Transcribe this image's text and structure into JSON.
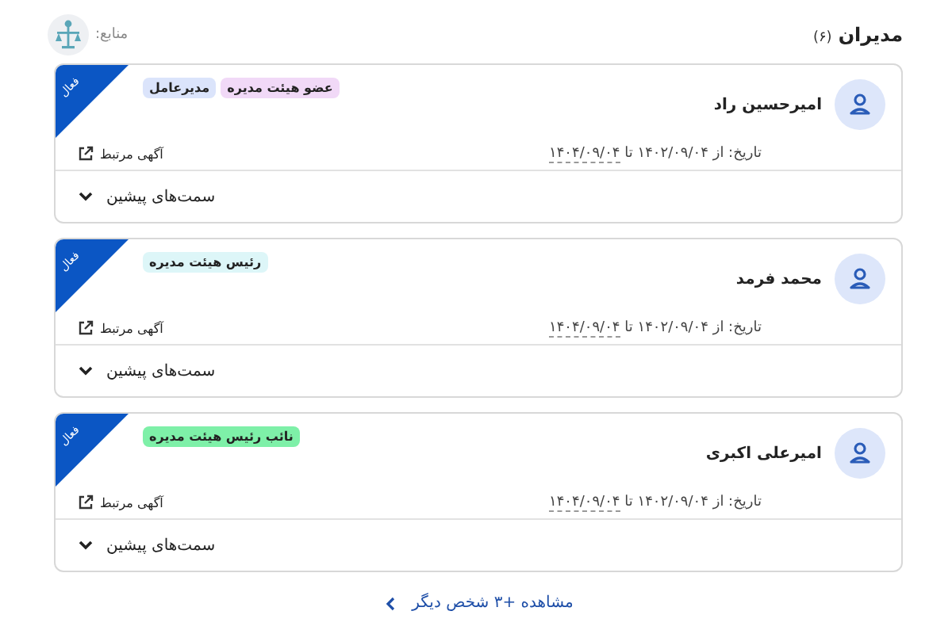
{
  "header": {
    "title": "مدیران",
    "count": "(۶)",
    "sources_label": "منابع:"
  },
  "managers": [
    {
      "name": "امیرحسین راد",
      "status": "فعال",
      "tags": [
        {
          "label": "عضو هیئت مدیره",
          "color": "#f1d9f7"
        },
        {
          "label": "مدیرعامل",
          "color": "#dbe4fb"
        }
      ],
      "date_text": "تاریخ: از ۱۴۰۲/۰۹/۰۴ تا",
      "end_date": "۱۴۰۴/۰۹/۰۴",
      "link": "آگهی مرتبط",
      "previous_roles": "سمت‌های پیشین"
    },
    {
      "name": "محمد فرمد",
      "status": "فعال",
      "tags": [
        {
          "label": "رئیس هیئت مدیره",
          "color": "#ddf6f8"
        }
      ],
      "date_text": "تاریخ: از ۱۴۰۲/۰۹/۰۴ تا",
      "end_date": "۱۴۰۴/۰۹/۰۴",
      "link": "آگهی مرتبط",
      "previous_roles": "سمت‌های پیشین"
    },
    {
      "name": "امیرعلی اکبری",
      "status": "فعال",
      "tags": [
        {
          "label": "نائب رئیس هیئت مدیره",
          "color": "#7ef0a8"
        }
      ],
      "date_text": "تاریخ: از ۱۴۰۲/۰۹/۰۴ تا",
      "end_date": "۱۴۰۴/۰۹/۰۴",
      "link": "آگهی مرتبط",
      "previous_roles": "سمت‌های پیشین"
    }
  ],
  "show_more": "مشاهده +۳ شخص دیگر"
}
